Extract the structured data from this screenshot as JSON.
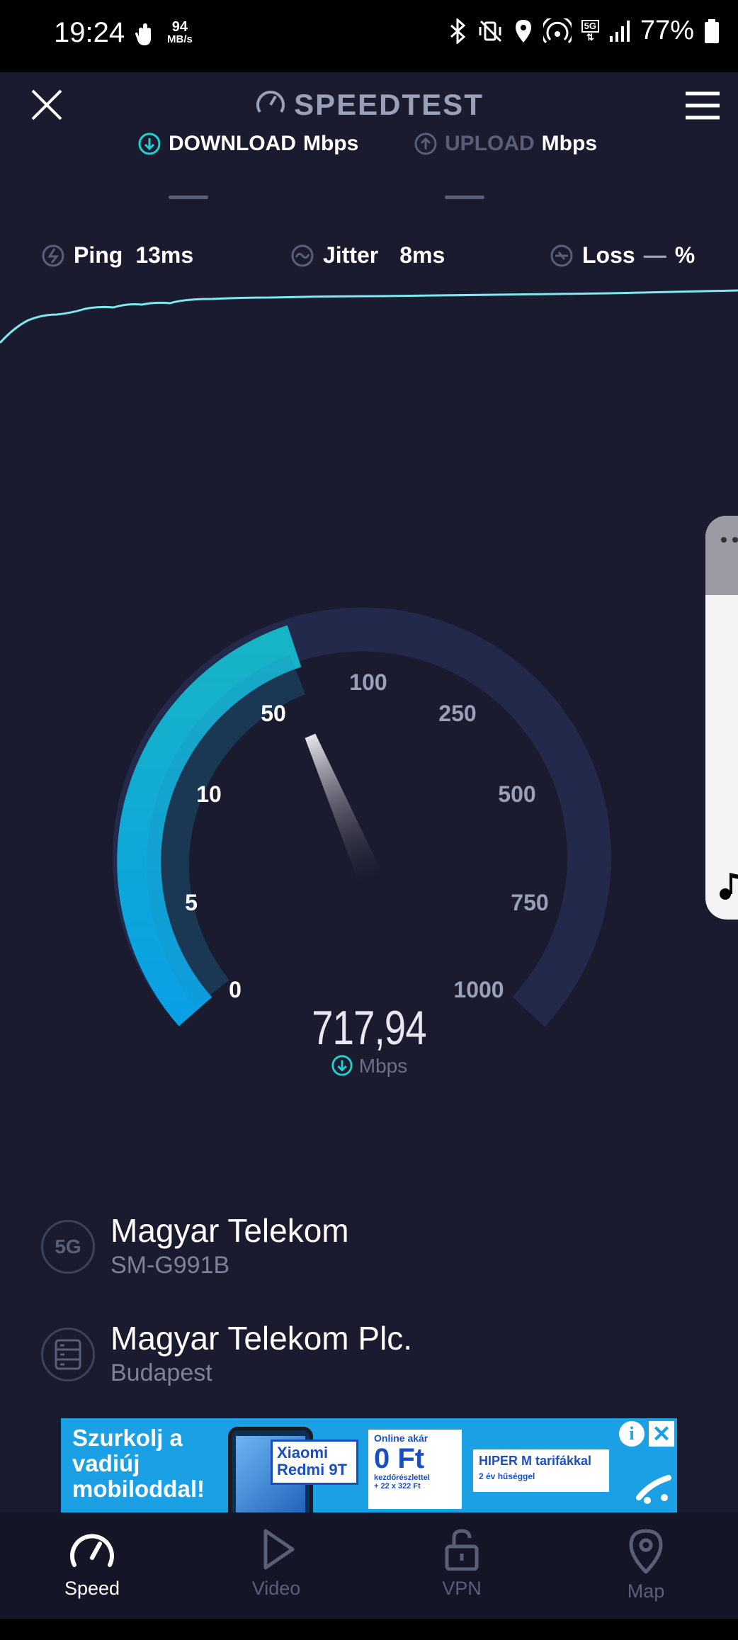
{
  "status_bar": {
    "time": "19:24",
    "data_rate_value": "94",
    "data_rate_unit": "MB/s",
    "network_badge": "5G",
    "battery": "77%"
  },
  "header": {
    "title": "SPEEDTEST",
    "download_tab": {
      "label": "DOWNLOAD",
      "unit": "Mbps"
    },
    "upload_tab": {
      "label": "UPLOAD",
      "unit": "Mbps"
    }
  },
  "metrics": {
    "ping_label": "Ping",
    "ping_value": "13ms",
    "jitter_label": "Jitter",
    "jitter_value": "8ms",
    "loss_label": "Loss",
    "loss_value": "—",
    "loss_unit": "%"
  },
  "gauge": {
    "ticks": [
      "0",
      "5",
      "10",
      "50",
      "100",
      "250",
      "500",
      "750",
      "1000"
    ],
    "speed_value": "717,94",
    "speed_unit": "Mbps",
    "accent_color": "#1ab3d1"
  },
  "connection": {
    "provider": "Magyar Telekom",
    "device": "SM-G991B",
    "server": "Magyar Telekom Plc.",
    "server_city": "Budapest",
    "badge": "5G"
  },
  "ad": {
    "headline_1": "Szurkolj a",
    "headline_2": "vadiúj",
    "headline_3": "mobiloddal!",
    "phone_1": "Xiaomi",
    "phone_2": "Redmi 9T",
    "price_top": "Online akár",
    "price": "0 Ft",
    "price_small": "kezdőrészlettel",
    "price_small_2": "+ 22 x 322 Ft",
    "plan": "HIPER M tarifákkal",
    "plan_small": "2 év hűséggel"
  },
  "nav": {
    "speed": "Speed",
    "video": "Video",
    "vpn": "VPN",
    "map": "Map"
  },
  "colors": {
    "background": "#1a1b2e",
    "accent": "#1ab3d1",
    "ad_blue": "#1ba0e6"
  }
}
